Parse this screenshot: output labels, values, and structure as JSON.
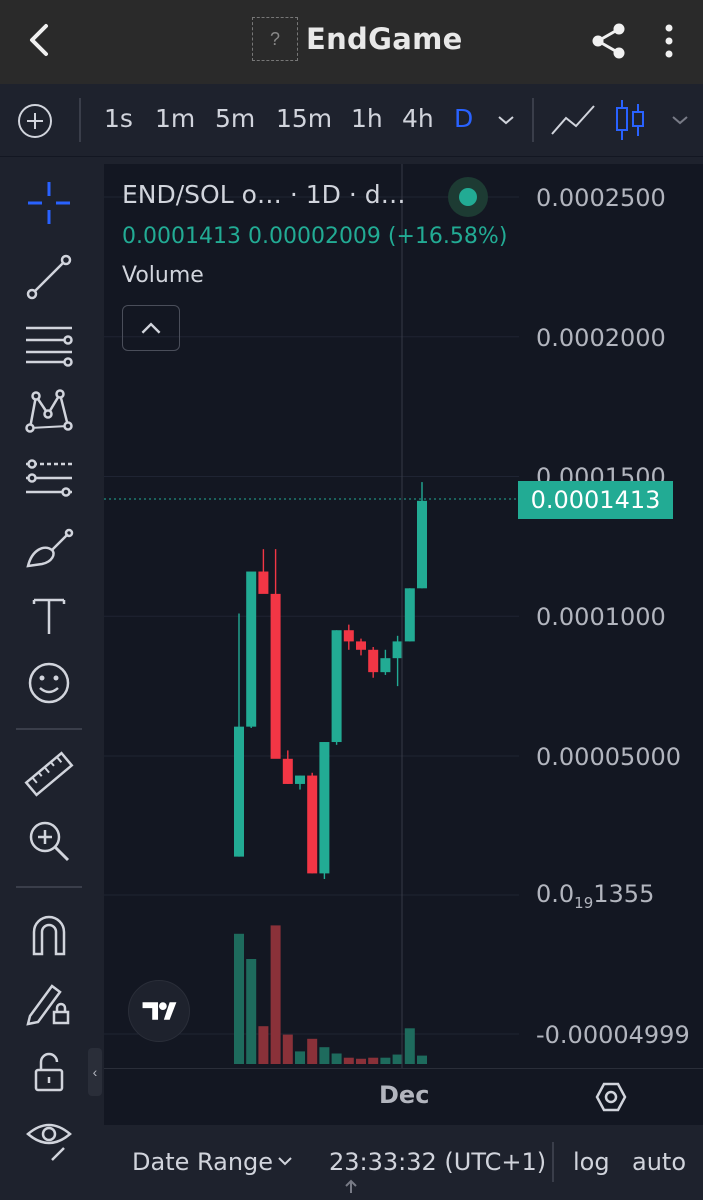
{
  "header": {
    "title": "EndGame",
    "logo_placeholder": "?"
  },
  "toolbar": {
    "timeframes": [
      "1s",
      "1m",
      "5m",
      "15m",
      "1h",
      "4h",
      "D"
    ],
    "active_timeframe": "D"
  },
  "legend": {
    "title": "END/SOL o… · 1D · d…",
    "values": "0.0001413  0.00002009 (+16.58%)",
    "volume_label": "Volume"
  },
  "price_axis": {
    "labels": [
      "0.0002500",
      "0.0002000",
      "0.0001500",
      "0.0001000",
      "0.00005000"
    ],
    "current_price": "0.0001413"
  },
  "volume_axis": {
    "label_top": "0.0",
    "label_sub": "19",
    "label_end": "1355",
    "label_bottom": "-0.00004999"
  },
  "xaxis": {
    "label": "Dec"
  },
  "bottom": {
    "date_range": "Date Range",
    "clock": "23:33:32 (UTC+1)",
    "log": "log",
    "auto": "auto"
  },
  "colors": {
    "up": "#22ab94",
    "down": "#f23645",
    "bg": "#131722",
    "accent": "#2962ff"
  },
  "chart_data": {
    "type": "candlestick",
    "interval": "1D",
    "y_scale_min": 5e-05,
    "y_scale_max": 0.00025,
    "candles": [
      {
        "o": 1.4e-05,
        "h": 0.000101,
        "l": 1.4e-05,
        "c": 6.05e-05,
        "v": 0.62
      },
      {
        "o": 6.05e-05,
        "h": 0.000115,
        "l": 6e-05,
        "c": 0.000116,
        "v": 0.5
      },
      {
        "o": 0.000116,
        "h": 0.000124,
        "l": 0.000115,
        "c": 0.000108,
        "v": 0.18
      },
      {
        "o": 0.000108,
        "h": 0.000124,
        "l": 5.5e-05,
        "c": 4.9e-05,
        "v": 0.66
      },
      {
        "o": 4.9e-05,
        "h": 5.2e-05,
        "l": 4e-05,
        "c": 4e-05,
        "v": 0.14
      },
      {
        "o": 4e-05,
        "h": 4.3e-05,
        "l": 3.8e-05,
        "c": 4.3e-05,
        "v": 0.06
      },
      {
        "o": 4.3e-05,
        "h": 4.4e-05,
        "l": 8e-06,
        "c": 8e-06,
        "v": 0.12
      },
      {
        "o": 8e-06,
        "h": 5.5e-05,
        "l": 6e-06,
        "c": 5.5e-05,
        "v": 0.08
      },
      {
        "o": 5.5e-05,
        "h": 9.5e-05,
        "l": 5.4e-05,
        "c": 9.5e-05,
        "v": 0.05
      },
      {
        "o": 9.5e-05,
        "h": 9.7e-05,
        "l": 8.8e-05,
        "c": 9.1e-05,
        "v": 0.03
      },
      {
        "o": 9.1e-05,
        "h": 9.2e-05,
        "l": 8.6e-05,
        "c": 8.8e-05,
        "v": 0.025
      },
      {
        "o": 8.8e-05,
        "h": 8.9e-05,
        "l": 7.8e-05,
        "c": 8e-05,
        "v": 0.03
      },
      {
        "o": 8e-05,
        "h": 8.8e-05,
        "l": 7.9e-05,
        "c": 8.5e-05,
        "v": 0.03
      },
      {
        "o": 8.5e-05,
        "h": 9.3e-05,
        "l": 7.5e-05,
        "c": 9.1e-05,
        "v": 0.045
      },
      {
        "o": 9.1e-05,
        "h": 0.00011,
        "l": 9.1e-05,
        "c": 0.00011,
        "v": 0.17
      },
      {
        "o": 0.00011,
        "h": 0.000148,
        "l": 0.00011,
        "c": 0.0001413,
        "v": 0.04
      }
    ]
  }
}
